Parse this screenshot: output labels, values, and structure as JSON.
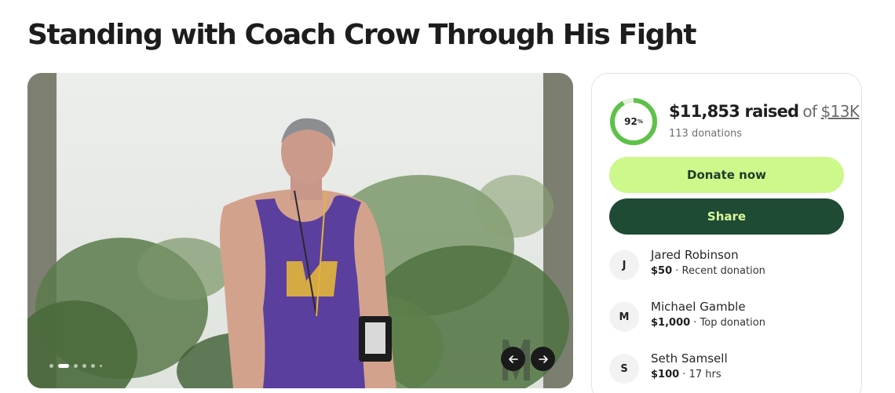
{
  "page": {
    "title": "Standing with Coach Crow Through His Fight"
  },
  "carousel": {
    "slide_count": 6,
    "active_index": 1,
    "prev_icon": "arrow-left-icon",
    "next_icon": "arrow-right-icon"
  },
  "progress": {
    "percent_label": "92",
    "percent_sign": "%",
    "fraction": 0.92,
    "raised": "$11,853 raised",
    "of": "of",
    "goal": "$13K",
    "donations": "113 donations"
  },
  "actions": {
    "donate_label": "Donate now",
    "share_label": "Share"
  },
  "donors": [
    {
      "initial": "J",
      "name": "Jared Robinson",
      "amount": "$50",
      "note": " · Recent donation"
    },
    {
      "initial": "M",
      "name": "Michael Gamble",
      "amount": "$1,000",
      "note": " · Top donation"
    },
    {
      "initial": "S",
      "name": "Seth Samsell",
      "amount": "$100",
      "note": " · 17 hrs"
    }
  ],
  "colors": {
    "accent_green": "#cdf88b",
    "dark_green": "#1f4a33",
    "ring_green": "#5ec24a",
    "ring_track": "#e3f1dc"
  }
}
